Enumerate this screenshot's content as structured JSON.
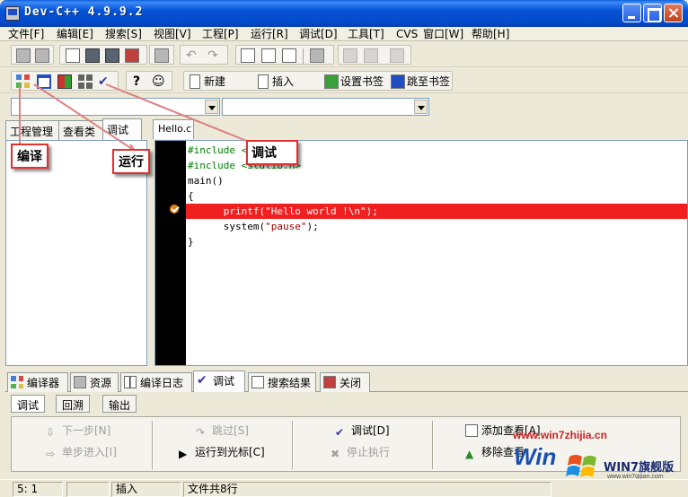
{
  "window": {
    "title": "Dev-C++ 4.9.9.2"
  },
  "menu": [
    "文件[F]",
    "编辑[E]",
    "搜索[S]",
    "视图[V]",
    "工程[P]",
    "运行[R]",
    "调试[D]",
    "工具[T]",
    "CVS",
    "窗口[W]",
    "帮助[H]"
  ],
  "toolbar2": {
    "new_label": "新建",
    "insert_label": "插入",
    "set_bookmark_label": "设置书签",
    "goto_bookmark_label": "跳至书签"
  },
  "left_tabs": [
    "工程管理",
    "查看类",
    "调试"
  ],
  "editor": {
    "tab": "Hello.c",
    "lines": [
      {
        "kind": "pre",
        "text": "#include <stdio.h>"
      },
      {
        "kind": "pre",
        "text": "#include <stdlib.h>"
      },
      {
        "kind": "plain",
        "text": "main()"
      },
      {
        "kind": "plain",
        "text": "{"
      },
      {
        "kind": "bp",
        "text": "      printf(\"Hello world !\\n\");"
      },
      {
        "kind": "plain",
        "text": "      system(\"pause\");"
      },
      {
        "kind": "plain",
        "text": "}"
      }
    ]
  },
  "callouts": {
    "compile": "编译",
    "run": "运行",
    "debug": "调试"
  },
  "bottom_tabs": [
    "编译器",
    "资源",
    "编译日志",
    "调试",
    "搜索结果",
    "关闭"
  ],
  "sub_tabs": [
    "调试",
    "回溯",
    "输出"
  ],
  "debug_buttons": {
    "next_step": "下一步[N]",
    "step_into": "单步进入[I]",
    "skip": "跳过[S]",
    "run_to_cursor": "运行到光标[C]",
    "debug": "调试[D]",
    "stop": "停止执行",
    "add_watch": "添加查看[A]",
    "remove_watch": "移除查看"
  },
  "status": {
    "position": "5: 1",
    "mode": "插入",
    "info": "文件共8行"
  },
  "watermark": {
    "url": "www.win7zhijia.cn",
    "win": "Win",
    "badge": "WIN7旗舰版",
    "small": "www.win7qijian.com"
  },
  "colors": {
    "breakpoint": "#f02020",
    "callout_border": "#e03030",
    "title_bar": "#0453d6"
  }
}
